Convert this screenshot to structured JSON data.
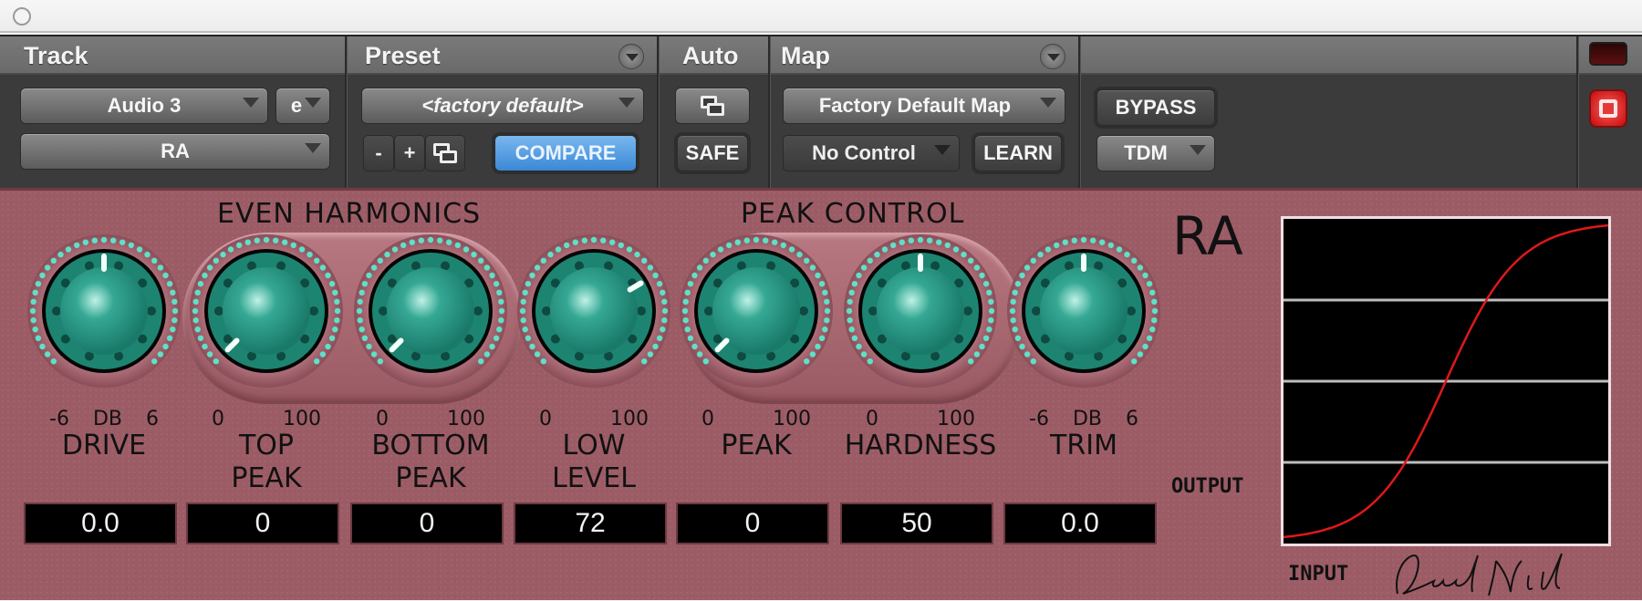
{
  "window": {
    "title_control": "window-dot"
  },
  "header": {
    "sections": {
      "track": "Track",
      "preset": "Preset",
      "auto": "Auto",
      "map": "Map"
    },
    "track": {
      "track_select": "Audio 3",
      "channel_select": "e",
      "plugin_select": "RA"
    },
    "preset": {
      "preset_select": "<factory default>",
      "prev_label": "-",
      "next_label": "+",
      "compare_label": "COMPARE"
    },
    "auto": {
      "safe_label": "SAFE"
    },
    "map": {
      "map_select": "Factory Default Map",
      "control_select": "No Control",
      "learn_label": "LEARN"
    },
    "misc": {
      "bypass_label": "BYPASS",
      "format_select": "TDM"
    },
    "colors": {
      "compare_active": "#4a92dc",
      "power": "#d41a1a"
    }
  },
  "plugin": {
    "logo": "RA",
    "groups": {
      "even_harmonics": "EVEN HARMONICS",
      "peak_control": "PEAK CONTROL"
    },
    "knobs": [
      {
        "id": "drive",
        "label": "DRIVE",
        "scale_min": "-6",
        "scale_mid": "DB",
        "scale_max": "6",
        "value": "0.0",
        "position": 0.5
      },
      {
        "id": "top-peak",
        "label": "TOP\nPEAK",
        "scale_min": "0",
        "scale_mid": "",
        "scale_max": "100",
        "value": "0",
        "position": 0.0
      },
      {
        "id": "bottom-peak",
        "label": "BOTTOM\nPEAK",
        "scale_min": "0",
        "scale_mid": "",
        "scale_max": "100",
        "value": "0",
        "position": 0.0
      },
      {
        "id": "low-level",
        "label": "LOW\nLEVEL",
        "scale_min": "0",
        "scale_mid": "",
        "scale_max": "100",
        "value": "72",
        "position": 0.72
      },
      {
        "id": "peak",
        "label": "PEAK",
        "scale_min": "0",
        "scale_mid": "",
        "scale_max": "100",
        "value": "0",
        "position": 0.0
      },
      {
        "id": "hardness",
        "label": "HARDNESS",
        "scale_min": "0",
        "scale_mid": "",
        "scale_max": "100",
        "value": "50",
        "position": 0.5
      },
      {
        "id": "trim",
        "label": "TRIM",
        "scale_min": "-6",
        "scale_mid": "DB",
        "scale_max": "6",
        "value": "0.0",
        "position": 0.5
      }
    ],
    "graph": {
      "output_label": "OUTPUT",
      "input_label": "INPUT",
      "curve": "s-curve transfer function",
      "curve_color": "#e01818",
      "gridlines": 3
    },
    "signature": "David Hill",
    "colors": {
      "panel": "#9c5c66",
      "knob": "#1f8a78",
      "led": "#5fe0c8"
    }
  }
}
